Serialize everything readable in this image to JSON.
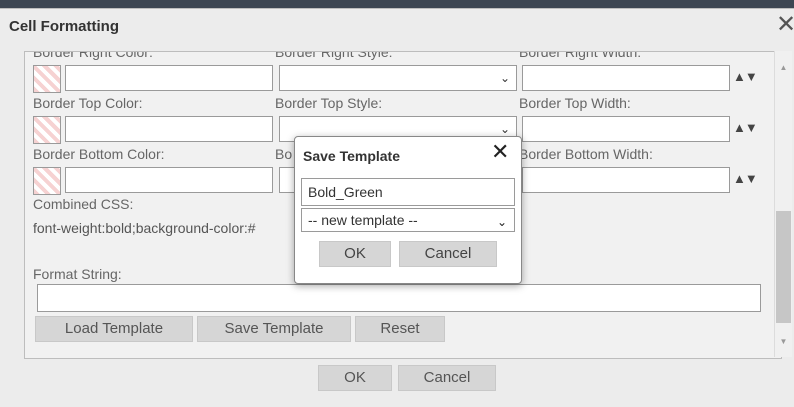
{
  "dialog": {
    "title": "Cell Formatting",
    "close_glyph": "✕"
  },
  "fields": {
    "border_right_color_label": "Border Right Color:",
    "border_right_style_label": "Border Right Style:",
    "border_right_width_label": "Border Right Width:",
    "border_top_color_label": "Border Top Color:",
    "border_top_style_label": "Border Top Style:",
    "border_top_width_label": "Border Top Width:",
    "border_bottom_color_label": "Border Bottom Color:",
    "border_bottom_style_label": "Bo",
    "border_bottom_width_label": "Border Bottom Width:",
    "combined_css_label": "Combined CSS:",
    "combined_css_value": "font-weight:bold;background-color:#",
    "format_string_label": "Format String:",
    "format_string_value": ""
  },
  "buttons": {
    "load_template": "Load Template",
    "save_template": "Save Template",
    "reset": "Reset",
    "ok": "OK",
    "cancel": "Cancel"
  },
  "modal": {
    "title": "Save Template",
    "close_glyph": "✕",
    "name_value": "Bold_Green",
    "template_select_value": "-- new template --",
    "ok": "OK",
    "cancel": "Cancel"
  },
  "icons": {
    "caret": "⌄",
    "spinner": "▲▼"
  }
}
